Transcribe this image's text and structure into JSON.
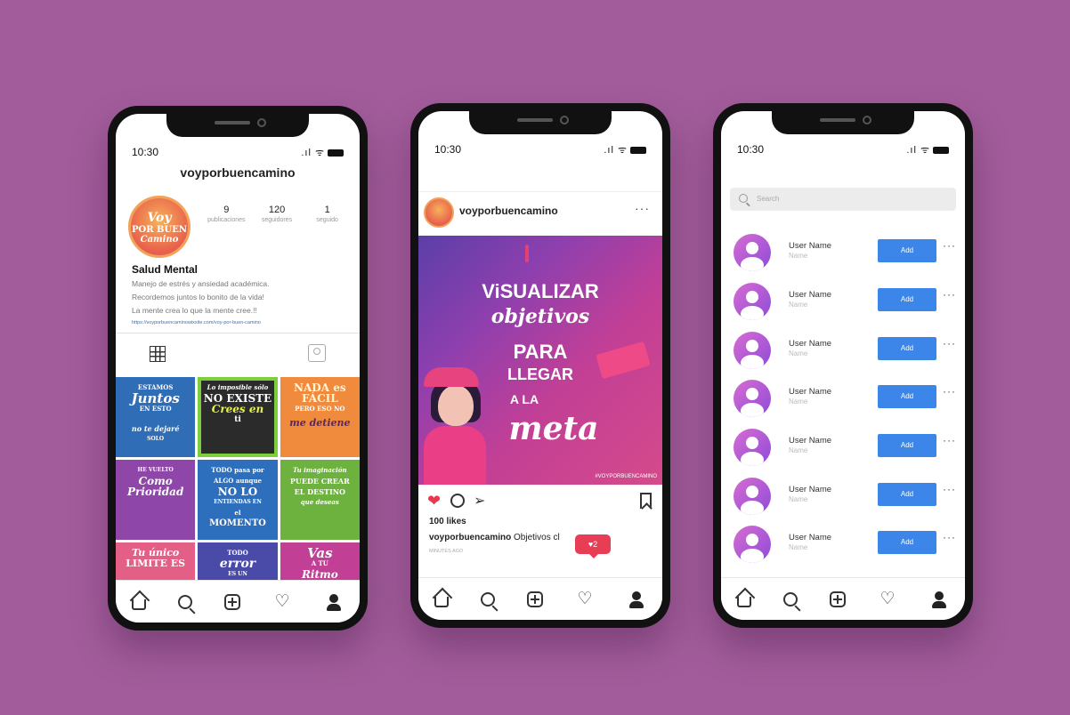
{
  "status": {
    "time": "10:30",
    "icons": ".ıl ᯤ"
  },
  "profile": {
    "username": "voyporbuencamino",
    "avatar_text": [
      "Voy",
      "POR BUEN",
      "Camino"
    ],
    "stats": [
      {
        "num": "9",
        "label": "publicaciones"
      },
      {
        "num": "120",
        "label": "seguidores"
      },
      {
        "num": "1",
        "label": "seguido"
      }
    ],
    "bio_name": "Salud Mental",
    "bio_lines": [
      "Manejo de estrés y ansiedad académica.",
      "Recordemos juntos lo bonito de la vida!",
      "La mente crea lo que la mente cree.!!"
    ],
    "bio_link": "https://voyporbuencaminowixsite.com/voy-por-buen-camino",
    "tiles": [
      {
        "lines": [
          "ESTAMOS",
          "Juntos",
          "EN ESTO",
          "no te dejaré",
          "SOLO"
        ],
        "bg": "#2f6db6"
      },
      {
        "lines": [
          "Lo imposible sólo",
          "NO EXISTE",
          "Crees en",
          "ti"
        ],
        "bg": "#2b2b2b"
      },
      {
        "lines": [
          "NADA es FÁCIL",
          "PERO ESO NO",
          "me detiene"
        ],
        "bg": "#f08a3c"
      },
      {
        "lines": [
          "HE VUELTO",
          "Como",
          "Prioridad"
        ],
        "bg": "#8e46a8"
      },
      {
        "lines": [
          "TODO pasa por",
          "ALGO aunque",
          "NO LO",
          "ENTIENDAS EN",
          "el",
          "MOMENTO"
        ],
        "bg": "#2d6fbc"
      },
      {
        "lines": [
          "Tu imaginación",
          "PUEDE CREAR",
          "EL DESTINO",
          "que deseas"
        ],
        "bg": "#6db23e"
      },
      {
        "lines": [
          "Tu único",
          "LIMITE ES"
        ],
        "bg": "#e35f86"
      },
      {
        "lines": [
          "TODO",
          "error",
          "ES UN"
        ],
        "bg": "#4a4ba8"
      },
      {
        "lines": [
          "Vas",
          "A TU",
          "Ritmo"
        ],
        "bg": "#c23f96"
      }
    ]
  },
  "post": {
    "username": "voyporbuencamino",
    "more": "···",
    "image_text": [
      "ViSUALIZAR",
      "objetivos",
      "PARA",
      "LLEGAR",
      "A LA",
      "meta"
    ],
    "hashtag": "#VOYPORBUENCAMINO",
    "likes": "100 likes",
    "caption_user": "voyporbuencamino",
    "caption_text": "Objetivos cl",
    "time_ago": "MINUTES AGO",
    "notification": "♥2"
  },
  "suggestions": {
    "search_placeholder": "Search",
    "users": [
      {
        "name": "User Name",
        "sub": "Name",
        "action": "Add"
      },
      {
        "name": "User Name",
        "sub": "Name",
        "action": "Add"
      },
      {
        "name": "User Name",
        "sub": "Name",
        "action": "Add"
      },
      {
        "name": "User Name",
        "sub": "Name",
        "action": "Add"
      },
      {
        "name": "User Name",
        "sub": "Name",
        "action": "Add"
      },
      {
        "name": "User Name",
        "sub": "Name",
        "action": "Add"
      },
      {
        "name": "User Name",
        "sub": "Name",
        "action": "Add"
      }
    ],
    "more": "···"
  },
  "nav": [
    "home-icon",
    "search-icon",
    "add-icon",
    "heart-icon",
    "profile-icon"
  ],
  "colors": {
    "background": "#a25c9b",
    "accent": "#3b86e8",
    "like": "#e63950"
  }
}
